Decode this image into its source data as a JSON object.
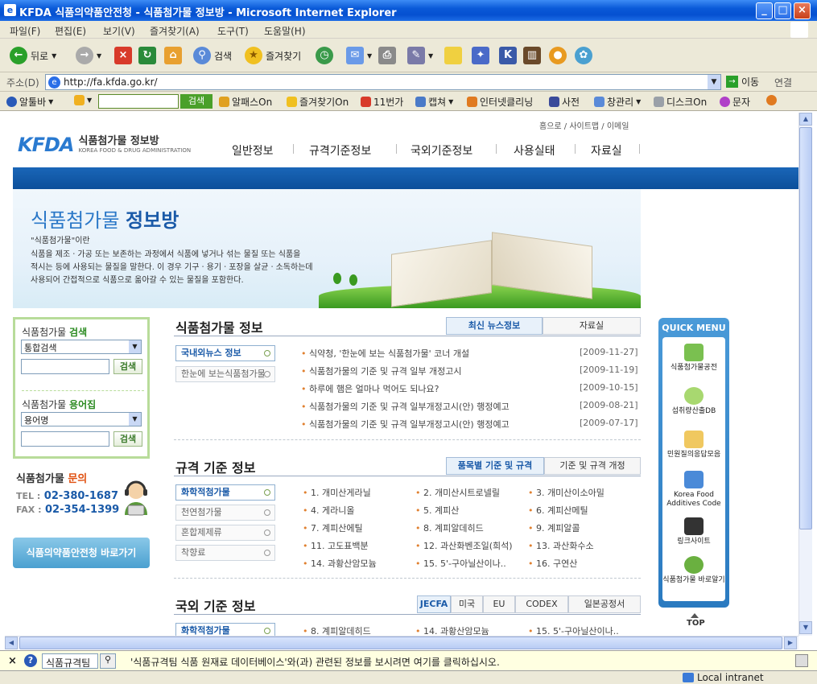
{
  "window": {
    "title": "KFDA 식품의약품안전청 - 식품첨가물 정보방 - Microsoft Internet Explorer",
    "controls": [
      "_",
      "□",
      "×"
    ]
  },
  "menubar": [
    "파일(F)",
    "편집(E)",
    "보기(V)",
    "즐겨찾기(A)",
    "도구(T)",
    "도움말(H)"
  ],
  "toolbar": {
    "back_label": "뒤로",
    "search_label": "검색",
    "favorites_label": "즐겨찾기"
  },
  "addressbar": {
    "label": "주소(D)",
    "url": "http://fa.kfda.go.kr/",
    "go_label": "이동",
    "links_label": "연결"
  },
  "linkbar": {
    "items": [
      "알툴바",
      "검색",
      "알패스On",
      "즐겨찾기On",
      "11번가",
      "캡쳐",
      "인터넷클리닝",
      "사전",
      "창관리",
      "디스크On",
      "문자"
    ]
  },
  "page": {
    "logo_name": "식품첨가물 정보방",
    "logo_sub": "KOREA FOOD & DRUG ADMINISTRATION",
    "logo_mark": "KFDA",
    "toplinks": "홈으로 / 사이트맵 / 이메일",
    "gnb": [
      "일반정보",
      "규격기준정보",
      "국외기준정보",
      "사용실태",
      "자료실"
    ],
    "hero": {
      "title_a": "식품첨가물",
      "title_b": "정보방",
      "question": "\"식품첨가물\"이란",
      "desc": [
        "식품을 제조ㆍ가공 또는 보존하는 과정에서 식품에 넣거나 섞는 물질 또는 식품을",
        "적시는 등에 사용되는 물질을 말한다. 이 경우 기구ㆍ용기ㆍ포장을 살균ㆍ소독하는데",
        "사용되어 간접적으로 식품으로 옮아갈 수 있는 물질을 포함한다."
      ]
    },
    "search": {
      "title_a": "식품첨가물",
      "title_b": "검색",
      "select": "통합검색",
      "button": "검색",
      "glossary_a": "식품첨가물",
      "glossary_b": "용어집",
      "glossary_select": "용어명",
      "glossary_button": "검색"
    },
    "contact": {
      "title_a": "식품첨가물",
      "title_b": "문의",
      "tel_label": "TEL :",
      "tel": "02-380-1687",
      "fax_label": "FAX :",
      "fax": "02-354-1399"
    },
    "kfda_button": "식품의약품안전청 바로가기",
    "info": {
      "title": "식품첨가물 정보",
      "tabs": [
        "최신 뉴스정보",
        "자료실"
      ],
      "subnav": [
        "국내외뉴스 정보",
        "한눈에 보는식품첨가물"
      ],
      "news": [
        {
          "title": "식약청, '한눈에 보는 식품첨가물' 코너 개설",
          "date": "[2009-11-27]"
        },
        {
          "title": "식품첨가물의 기준 및 규격 일부 개정고시",
          "date": "[2009-11-19]"
        },
        {
          "title": "하루에 햄은 얼마나 먹어도 되나요?",
          "date": "[2009-10-15]"
        },
        {
          "title": "식품첨가물의 기준 및 규격 일부개정고시(안) 행정예고",
          "date": "[2009-08-21]"
        },
        {
          "title": "식품첨가물의 기준 및 규격 일부개정고시(안) 행정예고",
          "date": "[2009-07-17]"
        }
      ]
    },
    "standards": {
      "title": "규격 기준 정보",
      "tabs": [
        "품목별 기준 및 규격",
        "기준 및 규격 개정"
      ],
      "subnav": [
        "화학적첨가물",
        "천연첨가물",
        "혼합제제류",
        "착향료"
      ],
      "items": [
        "1. 개미산게라닐",
        "2. 개미산시트로넬릴",
        "3. 개미산이소아밀",
        "4. 게라니올",
        "5. 계피산",
        "6. 계피산메틸",
        "7. 계피산에틸",
        "8. 계피알데히드",
        "9. 계피알콜",
        "11. 고도표백분",
        "12. 과산화벤조일(희석)",
        "13. 과산화수소",
        "14. 과황산암모늄",
        "15. 5'-구아닐산이나..",
        "16. 구연산"
      ]
    },
    "foreign": {
      "title": "국외 기준 정보",
      "tabs": [
        "JECFA",
        "미국",
        "EU",
        "CODEX",
        "일본공정서"
      ],
      "subnav": [
        "화학적첨가물"
      ],
      "items": [
        "8. 계피알데히드",
        "14. 과황산암모늄",
        "15. 5'-구아닐산이나.."
      ]
    },
    "quickmenu": {
      "title": "QUICK MENU",
      "items": [
        "식품첨가물공전",
        "섭취량산출DB",
        "민원질의응답모음",
        "Korea Food Additives Code",
        "링크사이트",
        "식품첨가물 바로알기"
      ],
      "top": "TOP"
    }
  },
  "infobar": {
    "button": "식품규격팀",
    "message": "'식품규격팀 식품 원재료 데이터베이스'와(과) 관련된 정보를 보시려면 여기를 클릭하십시오."
  },
  "statusbar": {
    "zone": "Local intranet"
  }
}
